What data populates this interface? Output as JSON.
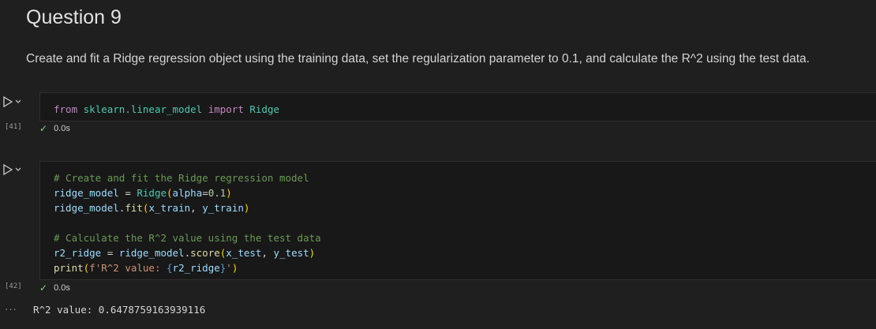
{
  "markdown": {
    "heading": "Question 9",
    "paragraph": "Create and fit a Ridge regression object using the training data, set the regularization parameter to 0.1, and calculate the R^2 using the test data."
  },
  "cells": [
    {
      "execution_count": "[41]",
      "duration": "0.0s",
      "code": {
        "from": "from",
        "module": "sklearn.linear_model",
        "import": "import",
        "name": "Ridge"
      }
    },
    {
      "execution_count": "[42]",
      "duration": "0.0s",
      "code": {
        "comment1": "# Create and fit the Ridge regression model",
        "l2_var": "ridge_model",
        "l2_eq": " = ",
        "l2_cls": "Ridge",
        "l2_open": "(",
        "l2_param": "alpha",
        "l2_eq2": "=",
        "l2_num": "0.1",
        "l2_close": ")",
        "l3_var": "ridge_model",
        "l3_dot": ".",
        "l3_fn": "fit",
        "l3_open": "(",
        "l3_a1": "x_train",
        "l3_sep": ", ",
        "l3_a2": "y_train",
        "l3_close": ")",
        "comment2": "# Calculate the R^2 value using the test data",
        "l6_var": "r2_ridge",
        "l6_eq": " = ",
        "l6_obj": "ridge_model",
        "l6_dot": ".",
        "l6_fn": "score",
        "l6_open": "(",
        "l6_a1": "x_test",
        "l6_sep": ", ",
        "l6_a2": "y_test",
        "l6_close": ")",
        "l7_fn": "print",
        "l7_open": "(",
        "l7_str1": "f'R^2 value: ",
        "l7_lb": "{",
        "l7_var": "r2_ridge",
        "l7_rb": "}",
        "l7_str2": "'",
        "l7_close": ")"
      },
      "output": "R^2 value: 0.6478759163939116"
    }
  ],
  "icons": {
    "run": "play-icon",
    "expand": "chevron-down-icon",
    "success": "checkmark-icon",
    "output_menu": "ellipsis-icon"
  },
  "ui": {
    "check_glyph": "✓",
    "dots_glyph": "···"
  }
}
